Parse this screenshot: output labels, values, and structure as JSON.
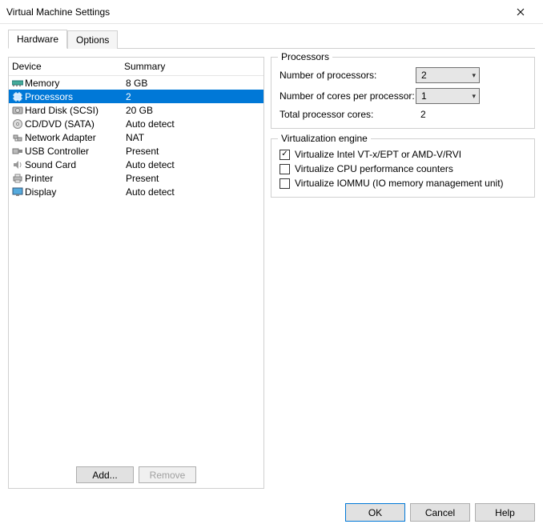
{
  "window": {
    "title": "Virtual Machine Settings"
  },
  "tabs": {
    "hardware": "Hardware",
    "options": "Options"
  },
  "columns": {
    "device": "Device",
    "summary": "Summary"
  },
  "devices": [
    {
      "name": "Memory",
      "summary": "8 GB",
      "icon": "memory"
    },
    {
      "name": "Processors",
      "summary": "2",
      "icon": "cpu",
      "selected": true
    },
    {
      "name": "Hard Disk (SCSI)",
      "summary": "20 GB",
      "icon": "hdd"
    },
    {
      "name": "CD/DVD (SATA)",
      "summary": "Auto detect",
      "icon": "cd"
    },
    {
      "name": "Network Adapter",
      "summary": "NAT",
      "icon": "net"
    },
    {
      "name": "USB Controller",
      "summary": "Present",
      "icon": "usb"
    },
    {
      "name": "Sound Card",
      "summary": "Auto detect",
      "icon": "sound"
    },
    {
      "name": "Printer",
      "summary": "Present",
      "icon": "printer"
    },
    {
      "name": "Display",
      "summary": "Auto detect",
      "icon": "display"
    }
  ],
  "list_buttons": {
    "add": "Add...",
    "remove": "Remove"
  },
  "processors_group": {
    "title": "Processors",
    "num_proc_label": "Number of processors:",
    "num_proc_value": "2",
    "cores_label": "Number of cores per processor:",
    "cores_value": "1",
    "total_label": "Total processor cores:",
    "total_value": "2"
  },
  "virt_group": {
    "title": "Virtualization engine",
    "vt_label": "Virtualize Intel VT-x/EPT or AMD-V/RVI",
    "vt_checked": true,
    "perf_label": "Virtualize CPU performance counters",
    "perf_checked": false,
    "iommu_label": "Virtualize IOMMU (IO memory management unit)",
    "iommu_checked": false
  },
  "dialog_buttons": {
    "ok": "OK",
    "cancel": "Cancel",
    "help": "Help"
  }
}
